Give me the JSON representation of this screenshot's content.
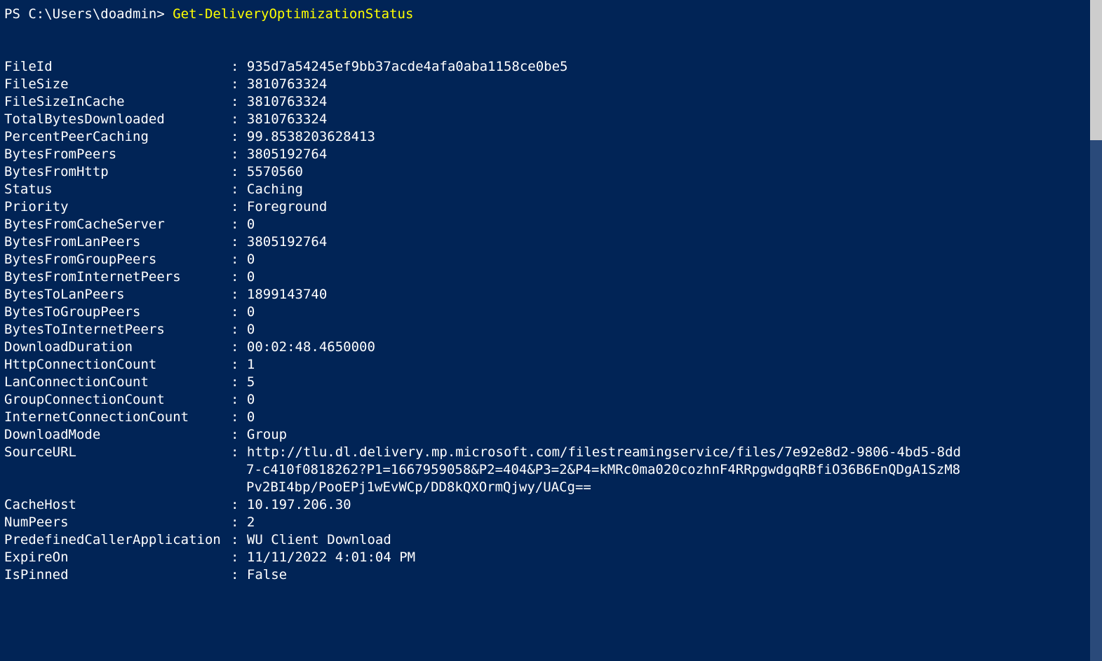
{
  "prompt": {
    "prefix": "PS C:\\Users\\doadmin> ",
    "command": "Get-DeliveryOptimizationStatus"
  },
  "props": {
    "FileId": "935d7a54245ef9bb37acde4afa0aba1158ce0be5",
    "FileSize": "3810763324",
    "FileSizeInCache": "3810763324",
    "TotalBytesDownloaded": "3810763324",
    "PercentPeerCaching": "99.8538203628413",
    "BytesFromPeers": "3805192764",
    "BytesFromHttp": "5570560",
    "Status": "Caching",
    "Priority": "Foreground",
    "BytesFromCacheServer": "0",
    "BytesFromLanPeers": "3805192764",
    "BytesFromGroupPeers": "0",
    "BytesFromInternetPeers": "0",
    "BytesToLanPeers": "1899143740",
    "BytesToGroupPeers": "0",
    "BytesToInternetPeers": "0",
    "DownloadDuration": "00:02:48.4650000",
    "HttpConnectionCount": "1",
    "LanConnectionCount": "5",
    "GroupConnectionCount": "0",
    "InternetConnectionCount": "0",
    "DownloadMode": "Group",
    "SourceURL_l1": "http://tlu.dl.delivery.mp.microsoft.com/filestreamingservice/files/7e92e8d2-9806-4bd5-8dd",
    "SourceURL_l2": "7-c410f0818262?P1=1667959058&P2=404&P3=2&P4=kMRc0ma020cozhnF4RRpgwdgqRBfiO36B6EnQDgA1SzM8",
    "SourceURL_l3": "Pv2BI4bp/PooEPj1wEvWCp/DD8kQXOrmQjwy/UACg==",
    "CacheHost": "10.197.206.30",
    "NumPeers": "2",
    "PredefinedCallerApplication": "WU Client Download",
    "ExpireOn": "11/11/2022 4:01:04 PM",
    "IsPinned": "False"
  }
}
